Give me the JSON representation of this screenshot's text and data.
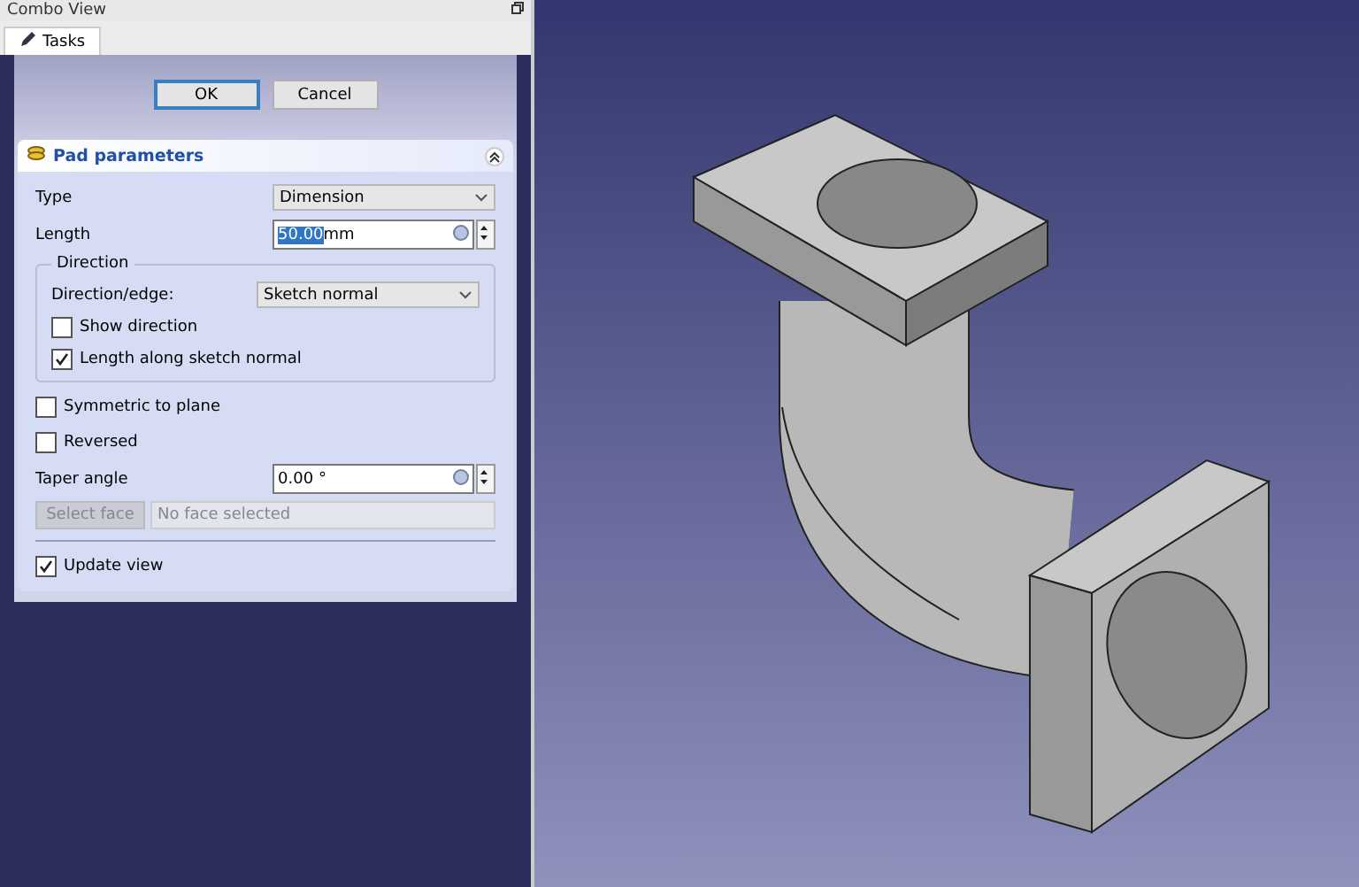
{
  "panel_title": "Combo View",
  "tabs": [
    {
      "label": "Tasks",
      "selected": true
    }
  ],
  "buttons": [
    {
      "label": "OK",
      "focused": true
    },
    {
      "label": "Cancel",
      "focused": false
    }
  ],
  "section": {
    "title": "Pad parameters",
    "expanded": true,
    "rows": [
      {
        "kind": "select",
        "label": "Type",
        "value": "Dimension"
      },
      {
        "kind": "quantity",
        "label": "Length",
        "value": "50.00",
        "unit": "mm",
        "highlighted": true
      },
      {
        "kind": "group",
        "label": "Direction",
        "rows": [
          {
            "kind": "select",
            "label": "Direction/edge:",
            "value": "Sketch normal"
          },
          {
            "kind": "checkbox",
            "label": "Show direction",
            "checked": false
          },
          {
            "kind": "checkbox",
            "label": "Length along sketch normal",
            "checked": true
          }
        ]
      },
      {
        "kind": "checkbox",
        "label": "Symmetric to plane",
        "checked": false
      },
      {
        "kind": "checkbox",
        "label": "Reversed",
        "checked": false
      },
      {
        "kind": "quantity",
        "label": "Taper angle",
        "value": "0.00",
        "unit": "°",
        "highlighted": false
      },
      {
        "kind": "picker",
        "button": "Select face",
        "placeholder": "No face selected",
        "disabled": true
      },
      {
        "kind": "divider"
      },
      {
        "kind": "checkbox",
        "label": "Update view",
        "checked": true
      }
    ]
  }
}
